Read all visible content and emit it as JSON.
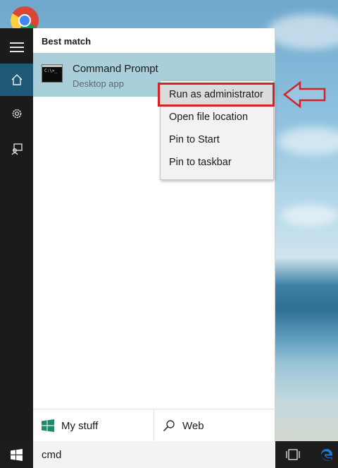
{
  "start_menu": {
    "section_heading": "Best match",
    "result": {
      "name": "Command Prompt",
      "type": "Desktop app"
    },
    "rail": {
      "items": [
        {
          "icon": "hamburger-menu-icon"
        },
        {
          "icon": "home-icon",
          "active": true
        },
        {
          "icon": "settings-gear-icon"
        },
        {
          "icon": "feedback-icon"
        }
      ]
    },
    "filters": {
      "my_stuff": "My stuff",
      "web": "Web"
    }
  },
  "context_menu": {
    "items": [
      "Run as administrator",
      "Open file location",
      "Pin to Start",
      "Pin to taskbar"
    ],
    "highlighted_index": 0
  },
  "taskbar": {
    "search_value": "cmd"
  },
  "annotation": {
    "color": "#d2232a"
  },
  "colors": {
    "accent": "#1e5a78",
    "selected_result": "#a9cfda",
    "taskbar": "#1c1c1c",
    "edge_blue": "#1f7ad4"
  }
}
